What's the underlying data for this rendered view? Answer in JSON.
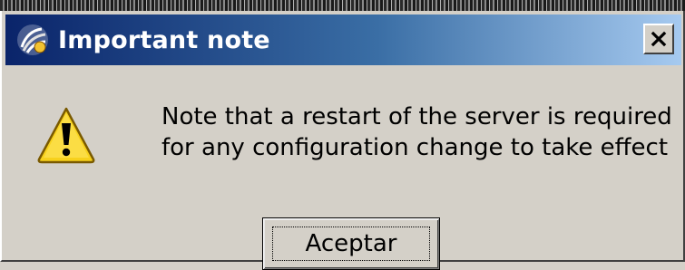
{
  "dialog": {
    "title": "Important note",
    "app_icon": "app-logo-icon",
    "close_icon": "close-icon",
    "warning_icon": "warning-icon",
    "message_lines": [
      "Note that a restart of the server is required",
      "for any configuration change to take effect"
    ],
    "ok_label": "Aceptar"
  },
  "colors": {
    "title_start": "#0a246a",
    "title_end": "#a6caf0",
    "face": "#d4d0c8",
    "warning_yellow": "#f7d11c"
  }
}
